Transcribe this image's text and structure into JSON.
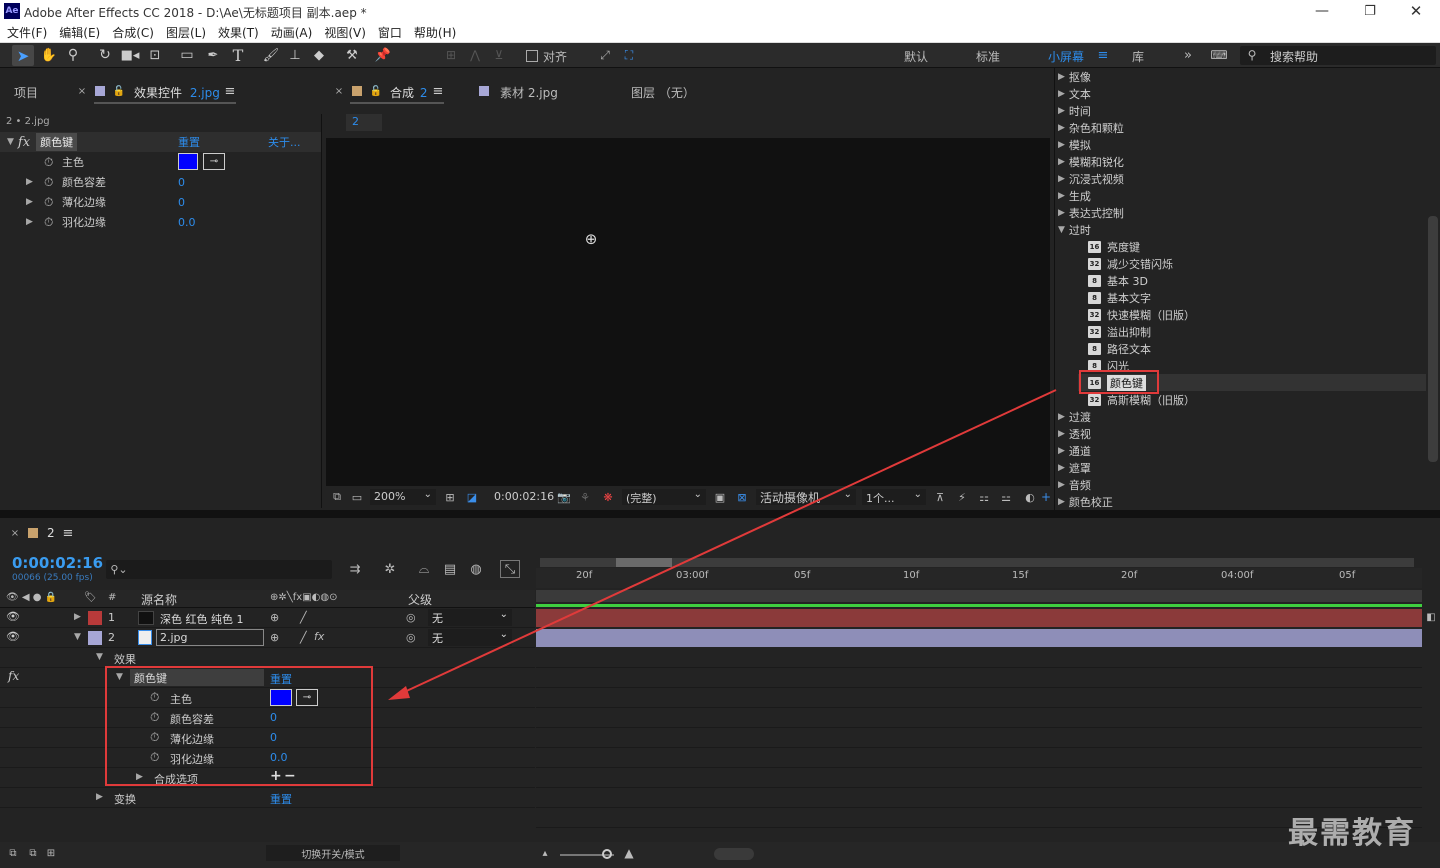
{
  "app": {
    "title": "Adobe After Effects CC 2018 - D:\\Ae\\无标题项目 副本.aep *",
    "logo": "Ae"
  },
  "menu": [
    "文件(F)",
    "编辑(E)",
    "合成(C)",
    "图层(L)",
    "效果(T)",
    "动画(A)",
    "视图(V)",
    "窗口",
    "帮助(H)"
  ],
  "toolbar": {
    "align_label": "对齐",
    "workspaces": [
      "默认",
      "标准",
      "小屏幕",
      "库"
    ],
    "active_workspace": "小屏幕",
    "search_placeholder": "搜索帮助"
  },
  "left_panel": {
    "tab_project": "项目",
    "tab_effects": "效果控件",
    "tab_effects_file": "2.jpg",
    "crumb": "2 • 2.jpg",
    "effect_name": "颜色键",
    "reset": "重置",
    "about": "关于...",
    "props": [
      {
        "name": "主色",
        "value": ""
      },
      {
        "name": "颜色容差",
        "value": "0"
      },
      {
        "name": "薄化边缘",
        "value": "0"
      },
      {
        "name": "羽化边缘",
        "value": "0.0"
      }
    ],
    "key_color": "#0000ff"
  },
  "comp_panel": {
    "tabs": [
      "合成 2",
      "素材 2.jpg",
      "图层 （无）"
    ],
    "comp_tab_label": "合成",
    "comp_tab_num": "2",
    "sub_tab": "2",
    "zoom": "200%",
    "timecode": "0:00:02:16",
    "quality": "(完整)",
    "camera": "活动摄像机",
    "views": "1个..."
  },
  "effects_panel": {
    "categories_top": [
      "抠像",
      "文本",
      "时间",
      "杂色和颗粒",
      "模拟",
      "模糊和锐化",
      "沉浸式视频",
      "生成",
      "表达式控制"
    ],
    "open_category": "过时",
    "items": [
      {
        "badge": "16",
        "name": "亮度键"
      },
      {
        "badge": "32",
        "name": "减少交错闪烁"
      },
      {
        "badge": "8",
        "name": "基本 3D"
      },
      {
        "badge": "8",
        "name": "基本文字"
      },
      {
        "badge": "32",
        "name": "快速模糊（旧版）"
      },
      {
        "badge": "32",
        "name": "溢出抑制"
      },
      {
        "badge": "8",
        "name": "路径文本"
      },
      {
        "badge": "8",
        "name": "闪光"
      },
      {
        "badge": "16",
        "name": "颜色键"
      },
      {
        "badge": "32",
        "name": "高斯模糊（旧版）"
      }
    ],
    "categories_bottom": [
      "过渡",
      "透视",
      "通道",
      "遮罩",
      "音频",
      "颜色校正"
    ],
    "highlighted": "颜色键"
  },
  "timeline": {
    "tab": "2",
    "timecode": "0:00:02:16",
    "fps": "00066 (25.00 fps)",
    "col_source": "源名称",
    "col_parent": "父级",
    "col_num": "#",
    "ruler": [
      "20f",
      "03:00f",
      "05f",
      "10f",
      "15f",
      "20f",
      "04:00f",
      "05f"
    ],
    "layers": [
      {
        "num": "1",
        "name": "深色 红色 纯色 1",
        "parent": "无",
        "color": "#b83a3a"
      },
      {
        "num": "2",
        "name": "2.jpg",
        "parent": "无",
        "color": "#a7a7d6"
      }
    ],
    "effects_label": "效果",
    "effect_name": "颜色键",
    "reset": "重置",
    "props": [
      {
        "name": "主色",
        "value": ""
      },
      {
        "name": "颜色容差",
        "value": "0"
      },
      {
        "name": "薄化边缘",
        "value": "0"
      },
      {
        "name": "羽化边缘",
        "value": "0.0"
      }
    ],
    "composite": "合成选项",
    "transform": "变换",
    "transform_reset": "重置",
    "toggle_mode": "切换开关/模式",
    "key_color": "#0000ff"
  },
  "watermark": "最需教育"
}
